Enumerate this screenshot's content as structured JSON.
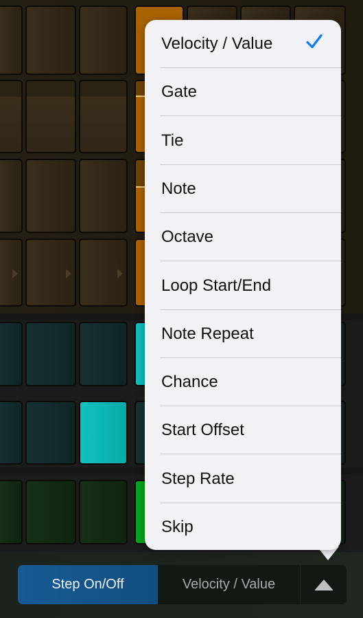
{
  "grid": {
    "rows": [
      {
        "color": "amber",
        "steps": [
          "off",
          "off",
          "off",
          "on",
          "off",
          "off",
          "off"
        ]
      },
      {
        "color": "amber",
        "steps": [
          "off-gate",
          "off-gate",
          "off-gate",
          "on",
          "off",
          "off",
          "off"
        ]
      },
      {
        "color": "amber",
        "steps": [
          "off",
          "off",
          "off",
          "on",
          "off",
          "off",
          "off"
        ]
      },
      {
        "color": "amber",
        "steps": [
          "off",
          "off",
          "off",
          "on",
          "off",
          "off",
          "off"
        ]
      },
      {
        "color": "teal",
        "steps": [
          "off",
          "off",
          "off",
          "on",
          "off",
          "off",
          "off"
        ]
      },
      {
        "color": "teal",
        "steps": [
          "off",
          "off",
          "on",
          "off",
          "off",
          "off",
          "off"
        ]
      },
      {
        "color": "green",
        "steps": [
          "off",
          "off",
          "off",
          "on",
          "off",
          "off",
          "off"
        ]
      }
    ]
  },
  "bottom_bar": {
    "step_on_off_label": "Step On/Off",
    "current_mode_label": "Velocity / Value",
    "menu_toggle_icon": "triangle-up-icon"
  },
  "menu": {
    "selected": "Velocity / Value",
    "check_icon": "checkmark-icon",
    "accent_color": "#0a7aff",
    "items": [
      {
        "label": "Velocity / Value",
        "checked": true
      },
      {
        "label": "Gate",
        "checked": false
      },
      {
        "label": "Tie",
        "checked": false
      },
      {
        "label": "Note",
        "checked": false
      },
      {
        "label": "Octave",
        "checked": false
      },
      {
        "label": "Loop Start/End",
        "checked": false
      },
      {
        "label": "Note Repeat",
        "checked": false
      },
      {
        "label": "Chance",
        "checked": false
      },
      {
        "label": "Start Offset",
        "checked": false
      },
      {
        "label": "Step Rate",
        "checked": false
      },
      {
        "label": "Skip",
        "checked": false
      }
    ]
  }
}
